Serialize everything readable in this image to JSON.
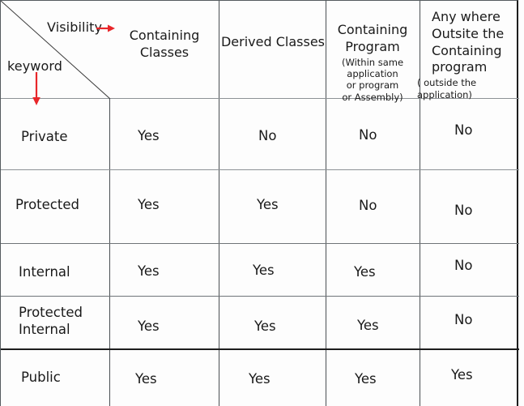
{
  "table": {
    "corner": {
      "column_axis_label": "Visibility",
      "row_axis_label": "keyword",
      "arrow_color": "#e8262a",
      "diagonal_color": "#3a3a3a"
    },
    "column_headers": [
      {
        "main": "Containing\nClasses",
        "sub": ""
      },
      {
        "main": "Derived Classes",
        "sub": ""
      },
      {
        "main": "Containing\nProgram",
        "sub": "(Within same application\nor program\nor Assembly)"
      },
      {
        "main": "Any where\nOutsite the\nContaining\nprogram",
        "sub": "( outside the application)"
      }
    ],
    "rows": [
      {
        "label": "Private",
        "values": [
          "Yes",
          "No",
          "No",
          "No"
        ]
      },
      {
        "label": "Protected",
        "values": [
          "Yes",
          "Yes",
          "No",
          "No"
        ]
      },
      {
        "label": "Internal",
        "values": [
          "Yes",
          "Yes",
          "Yes",
          "No"
        ]
      },
      {
        "label": "Protected\nInternal",
        "values": [
          "Yes",
          "Yes",
          "Yes",
          "No"
        ]
      },
      {
        "label": "Public",
        "values": [
          "Yes",
          "Yes",
          "Yes",
          "Yes"
        ]
      }
    ]
  }
}
